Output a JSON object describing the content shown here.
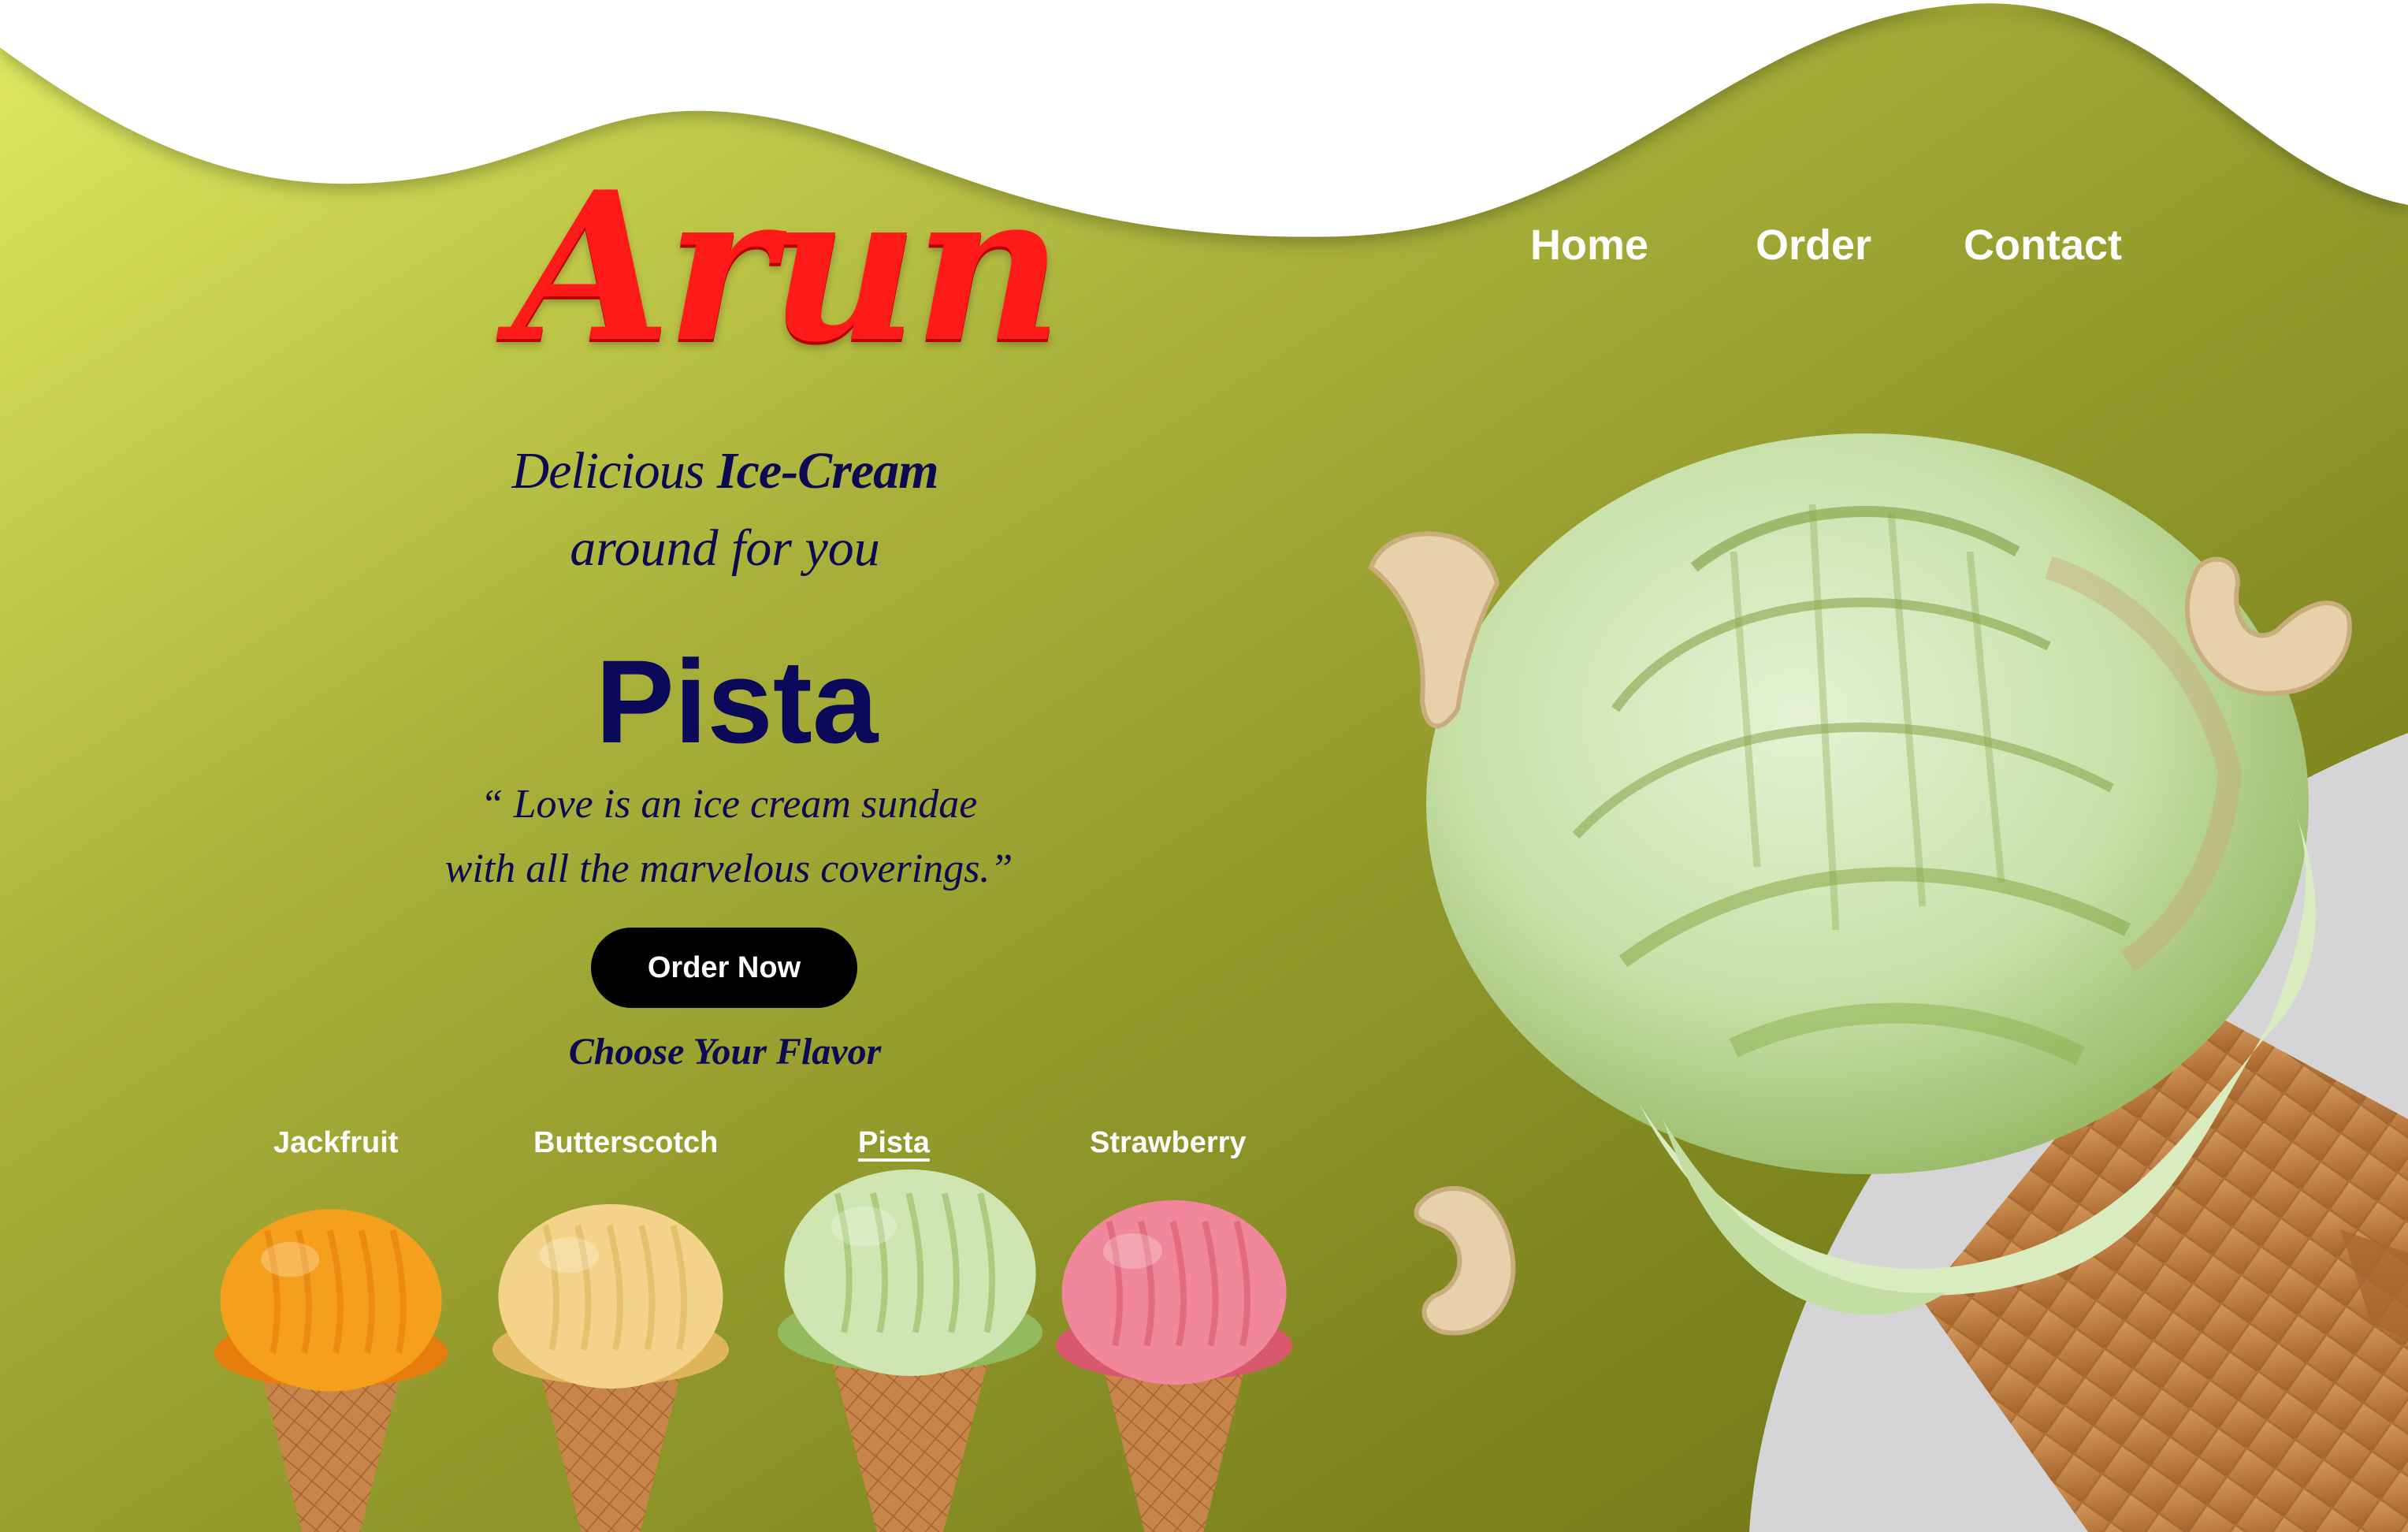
{
  "brand": {
    "logo_text": "Arun"
  },
  "nav": {
    "items": [
      {
        "label": "Home"
      },
      {
        "label": "Order"
      },
      {
        "label": "Contact"
      }
    ]
  },
  "hero": {
    "tagline_word1": "Delicious",
    "tagline_word2": "Ice-Cream",
    "tagline_line2": "around for you",
    "flavor_title": "Pista",
    "quote_line1": "“ Love is an ice cream sundae",
    "quote_line2": "with all the marvelous coverings.”",
    "order_button": "Order Now",
    "choose_label": "Choose Your Flavor"
  },
  "flavors": {
    "selected": "Pista",
    "items": [
      {
        "label": "Jackfruit",
        "scoop_color": "#f4a01c",
        "scoop_shade": "#e67d0c"
      },
      {
        "label": "Butterscotch",
        "scoop_color": "#f3d38a",
        "scoop_shade": "#deb55a"
      },
      {
        "label": "Pista",
        "scoop_color": "#cfe6b2",
        "scoop_shade": "#93ba5c"
      },
      {
        "label": "Strawberry",
        "scoop_color": "#f0879a",
        "scoop_shade": "#d9586e"
      }
    ]
  },
  "colors": {
    "bg_light": "#d8e25a",
    "bg_mid": "#a7ad36",
    "bg_dark": "#6f7618",
    "logo_red": "#ff1a1a",
    "text_navy": "#0d0a52",
    "button_black": "#000000",
    "cone": "#c8854a",
    "cashew": "#e6d1aa",
    "grey_panel": "#d5d5d8"
  }
}
